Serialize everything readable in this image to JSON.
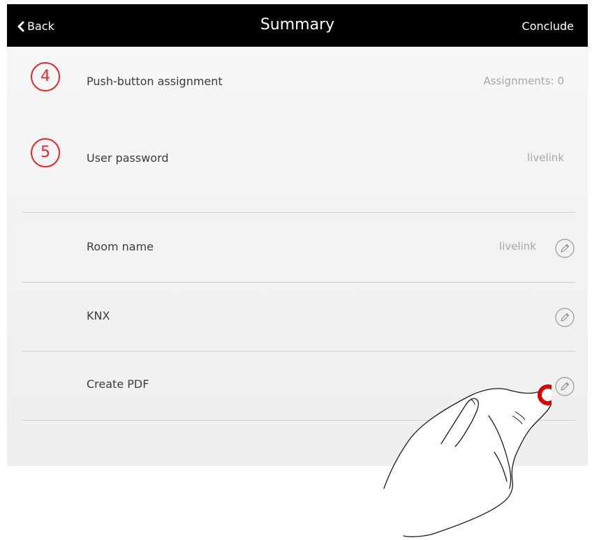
{
  "header": {
    "back_label": "Back",
    "title": "Summary",
    "conclude_label": "Conclude"
  },
  "steps": [
    {
      "number": "4",
      "label": "Push-button assignment",
      "value": "Assignments: 0"
    },
    {
      "number": "5",
      "label": "User password",
      "value": "livelink"
    }
  ],
  "rows": [
    {
      "label": "Room name",
      "value": "livelink"
    },
    {
      "label": "KNX",
      "value": ""
    },
    {
      "label": "Create PDF",
      "value": ""
    }
  ],
  "colors": {
    "accent": "#e8262b",
    "topbar": "#000000",
    "value_text": "#a6a6a6"
  },
  "icons": {
    "back": "chevron-left-icon",
    "edit": "pencil-icon"
  }
}
